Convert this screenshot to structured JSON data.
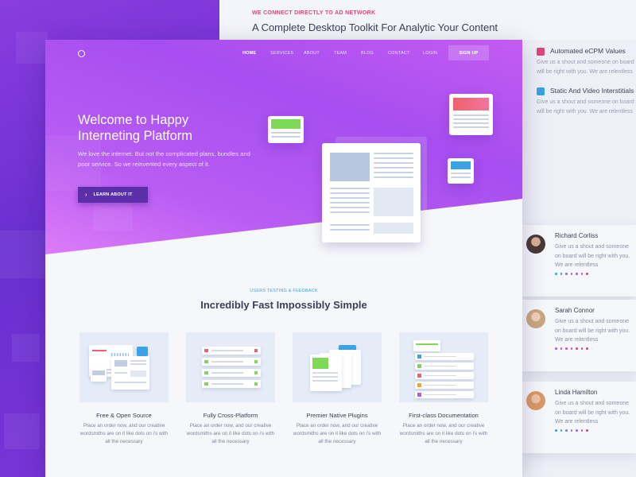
{
  "background": {
    "eyebrow": "WE CONNECT DIRECTLY TO AD NETWORK",
    "heading": "A Complete Desktop Toolkit For Analytic Your Content"
  },
  "features": [
    {
      "title": "Automated eCPM Values",
      "desc": "Give us a shout and someone on board will be right with you. We are relentless",
      "icon": "rocket-icon",
      "color": "#e0457a"
    },
    {
      "title": "Static And Video Interstitials",
      "desc": "Give us a shout and someone on board will be right with you. We are relentless",
      "icon": "heart-icon",
      "color": "#3aa3e6"
    }
  ],
  "testimonials": [
    {
      "name": "Richard Corliss",
      "text": "Give us a shout and someone on board will be right with you. We are relentless"
    },
    {
      "name": "Sarah Connor",
      "text": "Give us a shout and someone on board will be right with you. We are relentless"
    },
    {
      "name": "Linda Hamilton",
      "text": "Give us a shout and someone on board will be right with you. We are relentless"
    }
  ],
  "nav": {
    "items": [
      "HOME",
      "SERVICES",
      "ABOUT",
      "TEAM",
      "BLOG",
      "CONTACT",
      "LOGIN"
    ],
    "signup": "SIGN UP"
  },
  "hero": {
    "title": "Welcome to Happy Interneting Platform",
    "subtitle": "We love the internet. But not the complicated plans, bundles and poor service. So we reinvented every aspect of it.",
    "cta": "LEARN ABOUT IT",
    "cta_icon": "chevron-right-icon"
  },
  "section": {
    "eyebrow": "USERS TESTING & FEEDBACK",
    "title": "Incredibly Fast Impossibly Simple",
    "cards": [
      {
        "title": "Free & Open Source",
        "desc": "Place an order now, and our creative wordsmiths are on it like dots on i's with all the necessary"
      },
      {
        "title": "Fully Cross-Platform",
        "desc": "Place an order now, and our creative wordsmiths are on it like dots on i's with all the necessary"
      },
      {
        "title": "Premier Native Plugins",
        "desc": "Place an order now, and our creative wordsmiths are on it like dots on i's with all the necessary"
      },
      {
        "title": "First-class Documentation",
        "desc": "Place an order now, and our creative wordsmiths are on it like dots on i's with all the necessary"
      }
    ]
  },
  "colors": {
    "accent_purple": "#a64ef0",
    "cta_bg": "#5a2fa8",
    "eyebrow_pink": "#e0457a",
    "eyebrow_blue": "#3aa3e6",
    "green": "#7ed957",
    "red": "#f0616d"
  }
}
